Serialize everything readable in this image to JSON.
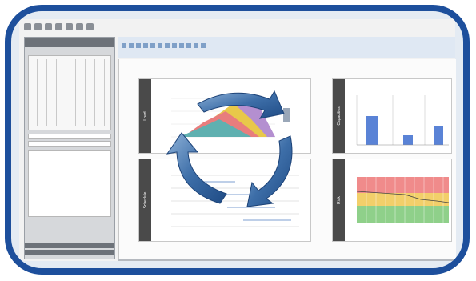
{
  "panels": {
    "top_left": "Load",
    "top_right": "Capacities",
    "bottom_left": "Schedule",
    "bottom_right": "Risk"
  },
  "colors": {
    "frame": "#1d4f9c",
    "arrow": "#3d6ea8",
    "bar": "#5a83d6"
  },
  "icons": [
    "cycle-arrow-icon"
  ]
}
